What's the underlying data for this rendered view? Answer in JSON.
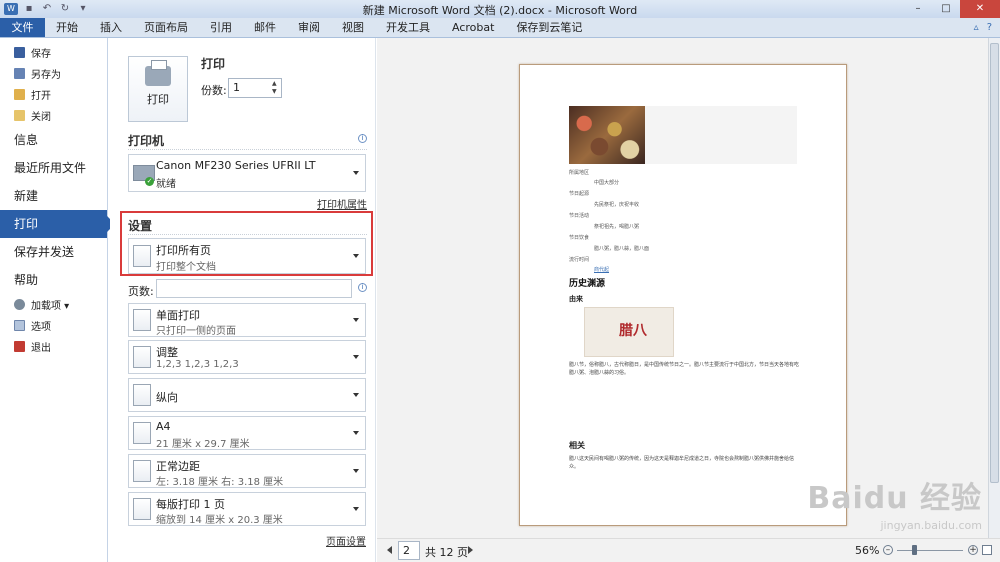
{
  "window": {
    "title": "新建 Microsoft Word 文档 (2).docx - Microsoft Word",
    "controls": {
      "minimize": "–",
      "maximize": "□",
      "close": "✕"
    }
  },
  "ribbon": {
    "tabs": [
      "文件",
      "开始",
      "插入",
      "页面布局",
      "引用",
      "邮件",
      "审阅",
      "视图",
      "开发工具",
      "Acrobat",
      "保存到云笔记"
    ],
    "help": "?"
  },
  "nav": {
    "small_top": [
      {
        "label": "保存",
        "icon": "save-icon"
      },
      {
        "label": "另存为",
        "icon": "save-as-icon"
      },
      {
        "label": "打开",
        "icon": "open-folder-icon"
      },
      {
        "label": "关闭",
        "icon": "close-document-icon"
      }
    ],
    "big": [
      "信息",
      "最近所用文件",
      "新建",
      "打印",
      "保存并发送",
      "帮助"
    ],
    "active": "打印",
    "small_bottom": [
      {
        "label": "加载项 ▾",
        "icon": "add-ins-icon"
      },
      {
        "label": "选项",
        "icon": "options-icon"
      },
      {
        "label": "退出",
        "icon": "exit-icon"
      }
    ]
  },
  "print": {
    "heading": "打印",
    "button_label": "打印",
    "copies_label": "份数:",
    "copies_value": "1"
  },
  "printer": {
    "heading": "打印机",
    "name": "Canon MF230 Series UFRII LT",
    "status": "就绪",
    "properties_link": "打印机属性"
  },
  "settings": {
    "heading": "设置",
    "pages_label": "页数:",
    "items": [
      {
        "line1": "打印所有页",
        "line2": "打印整个文档"
      },
      {
        "line1": "单面打印",
        "line2": "只打印一侧的页面"
      },
      {
        "line1": "调整",
        "line2": "1,2,3    1,2,3    1,2,3"
      },
      {
        "line1": "纵向",
        "line2": ""
      },
      {
        "line1": "A4",
        "line2": "21 厘米 x 29.7 厘米"
      },
      {
        "line1": "正常边距",
        "line2": "左: 3.18 厘米    右: 3.18 厘米"
      },
      {
        "line1": "每版打印 1 页",
        "line2": "缩放到 14 厘米 x 20.3 厘米"
      }
    ],
    "page_setup_link": "页面设置"
  },
  "preview": {
    "info_rows": [
      "所属地区",
      "中国大部分",
      "节日起源",
      "先民祭祀，庆祝丰收",
      "节日活动",
      "祭祀祖先，喝腊八粥",
      "节日饮食",
      "腊八粥，腊八蒜，腊八面",
      "流行时间",
      "商代起"
    ],
    "heading_history": "历史渊源",
    "heading_origin": "由来",
    "poster_text": "腊八",
    "heading_related": "相关",
    "para1": "腊八节，俗称腊八，古代称腊日，是中国传统节日之一。腊八节主要流行于中国北方，节日当天各地有吃腊八粥、泡腊八蒜的习俗。",
    "para2": "腊八这天民间有喝腊八粥的传统，因为这天是释迦牟尼成道之日，寺院也会熬制腊八粥供佛并施舍给信众。"
  },
  "status": {
    "current_page": "2",
    "total_pages": "共 12 页",
    "zoom": "56%",
    "zoom_level": 0.56
  },
  "watermark": {
    "brand": "Baidu 经验",
    "url": "jingyan.baidu.com"
  }
}
